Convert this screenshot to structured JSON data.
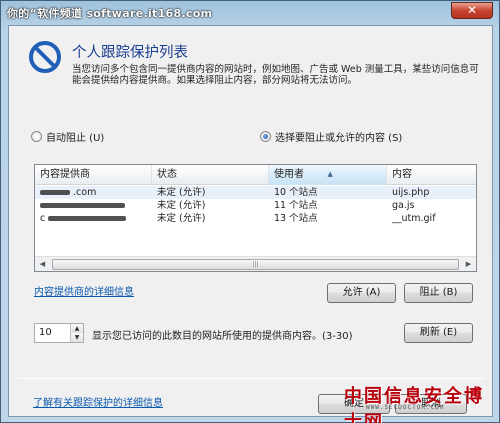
{
  "window": {
    "title": "你的“软件频道 software.it168.com",
    "close_glyph": "✕"
  },
  "header": {
    "title": "个人跟踪保护列表",
    "description": "当您访问多个包含同一提供商内容的网站时，例如地图、广告或 Web 测量工具，某些访问信息可能会提供给内容提供商。如果选择阻止内容，部分网站将无法访问。"
  },
  "options": {
    "auto_block": "自动阻止 (U)",
    "choose": "选择要阻止或允许的内容 (S)",
    "selected": "choose"
  },
  "table": {
    "columns": [
      "内容提供商",
      "状态",
      "使用者",
      "内容"
    ],
    "sorted_column": "使用者",
    "rows": [
      {
        "provider": ".com",
        "status": "未定 (允许)",
        "used_by": "10 个站点",
        "content": "uijs.php"
      },
      {
        "provider": "",
        "status": "未定 (允许)",
        "used_by": "11 个站点",
        "content": "ga.js"
      },
      {
        "provider": "c",
        "status": "未定 (允许)",
        "used_by": "13 个站点",
        "content": "__utm.gif"
      }
    ],
    "scroll_left": "◀",
    "scroll_right": "▶",
    "scroll_grip": "|||"
  },
  "links": {
    "provider_details": "内容提供商的详细信息",
    "about_tracking": "了解有关跟踪保护的详细信息"
  },
  "buttons": {
    "allow": "允许 (A)",
    "block": "阻止 (B)",
    "refresh": "刷新 (E)",
    "ok": "确定",
    "cancel": "取消"
  },
  "threshold": {
    "value": "10",
    "label": "显示您已访问的此数目的网站所使用的提供商内容。(3-30)"
  },
  "watermark": {
    "text": "中国信息安全博士网",
    "url": "WWW.SECDOCTOR.COM"
  },
  "colors": {
    "accent": "#1a3e90",
    "link": "#0a5ab0",
    "icon_ring": "#1f5fb8"
  }
}
